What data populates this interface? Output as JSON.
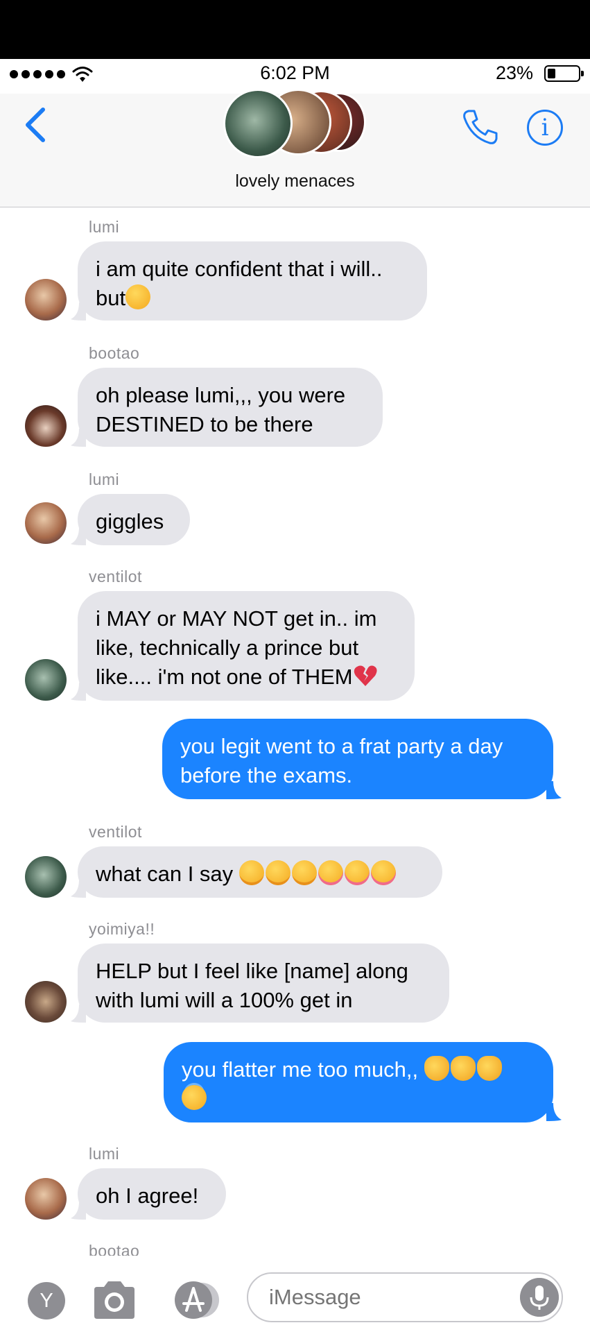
{
  "status_bar": {
    "time": "6:02 PM",
    "battery_percent": "23%",
    "battery_level": 0.23,
    "signal_dots": 5
  },
  "header": {
    "group_name": "lovely menaces",
    "back_icon": "chevron-left-icon",
    "call_icon": "phone-icon",
    "info_icon": "info-icon",
    "info_glyph": "i"
  },
  "messages": [
    {
      "direction": "in",
      "sender": "lumi",
      "text": "i am quite confident that i will..\nbut",
      "emoji": "pensive"
    },
    {
      "direction": "in",
      "sender": "bootao",
      "text": "oh please lumi,,, you were\nDESTINED to be there"
    },
    {
      "direction": "in",
      "sender": "lumi",
      "text": "giggles"
    },
    {
      "direction": "in",
      "sender": "ventilot",
      "text": "i MAY or MAY NOT get in.. im\nlike, technically a prince but\nlike.... i'm not one of THEM",
      "emoji": "broken-heart"
    },
    {
      "direction": "out",
      "text": "you legit went to a frat party a day\nbefore the exams."
    },
    {
      "direction": "in",
      "sender": "ventilot",
      "text": "what can I say ",
      "emoji": "drooling x3, yum x3"
    },
    {
      "direction": "in",
      "sender": "yoimiya!!",
      "text": "HELP but I feel like [name] along\nwith lumi will a 100% get in"
    },
    {
      "direction": "out",
      "text": "you flatter me too much,, ",
      "emoji": "smirking-cat x3, halo"
    },
    {
      "direction": "in",
      "sender": "lumi",
      "text": "oh I agree!"
    },
    {
      "direction": "in",
      "sender": "bootao"
    }
  ],
  "input_bar": {
    "apps_button_label": "Y",
    "placeholder": "iMessage",
    "camera_icon": "camera-icon",
    "appstore_icon": "app-store-icon",
    "mic_icon": "microphone-icon"
  },
  "colors": {
    "accent": "#1c7cf4",
    "outgoing_bubble": "#1b84ff",
    "incoming_bubble": "#e5e5ea",
    "sender_label": "#8e8e93"
  }
}
